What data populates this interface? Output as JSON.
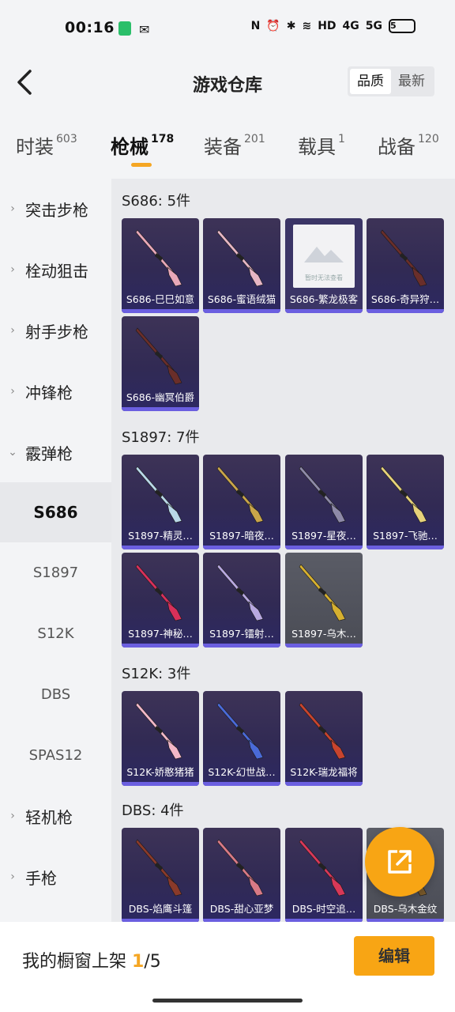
{
  "status_bar": {
    "time": "00:16",
    "network": "5G",
    "hd": "HD",
    "lte": "4G",
    "battery": "5"
  },
  "header": {
    "title": "游戏仓库",
    "sort_options": [
      "品质",
      "最新"
    ],
    "active_sort": "品质"
  },
  "category_tabs": [
    {
      "label": "时装",
      "count": "603"
    },
    {
      "label": "枪械",
      "count": "178",
      "active": true
    },
    {
      "label": "装备",
      "count": "201"
    },
    {
      "label": "载具",
      "count": "1"
    },
    {
      "label": "战备",
      "count": "120"
    }
  ],
  "sidebar": {
    "items": [
      {
        "label": "突击步枪",
        "type": "group"
      },
      {
        "label": "栓动狙击",
        "type": "group"
      },
      {
        "label": "射手步枪",
        "type": "group"
      },
      {
        "label": "冲锋枪",
        "type": "group"
      },
      {
        "label": "霰弹枪",
        "type": "group-open"
      },
      {
        "label": "S686",
        "type": "sub",
        "selected": true
      },
      {
        "label": "S1897",
        "type": "sub"
      },
      {
        "label": "S12K",
        "type": "sub"
      },
      {
        "label": "DBS",
        "type": "sub"
      },
      {
        "label": "SPAS12",
        "type": "sub"
      },
      {
        "label": "轻机枪",
        "type": "group"
      },
      {
        "label": "手枪",
        "type": "group"
      }
    ]
  },
  "groups": [
    {
      "title": "S686: 5件",
      "items": [
        {
          "name": "S686-巳巳如意",
          "color": "#e8a8b8"
        },
        {
          "name": "S686-蜜语绒猫",
          "color": "#e6b6c4"
        },
        {
          "name": "S686-繁龙极客",
          "placeholder": true,
          "placeholder_text": "暂时无法查看"
        },
        {
          "name": "S686-奇异狩…",
          "color": "#6a2e2a"
        },
        {
          "name": "S686-幽冥伯爵",
          "color": "#6a2e2a"
        }
      ]
    },
    {
      "title": "S1897: 7件",
      "items": [
        {
          "name": "S1897-精灵…",
          "color": "#b9d8e8"
        },
        {
          "name": "S1897-暗夜…",
          "color": "#c9a54a"
        },
        {
          "name": "S1897-星夜…",
          "color": "#8e8aa8"
        },
        {
          "name": "S1897-飞驰…",
          "color": "#e6d27a"
        },
        {
          "name": "S1897-神秘…",
          "color": "#d8305a"
        },
        {
          "name": "S1897-镭射…",
          "color": "#b8a8e0"
        },
        {
          "name": "S1897-乌木…",
          "color": "#d6b030",
          "grey": true
        }
      ]
    },
    {
      "title": "S12K: 3件",
      "items": [
        {
          "name": "S12K-娇憨猪猪",
          "color": "#f2b8c8"
        },
        {
          "name": "S12K-幻世战…",
          "color": "#4a6ad8"
        },
        {
          "name": "S12K-瑞龙福将",
          "color": "#c8442e"
        }
      ]
    },
    {
      "title": "DBS: 4件",
      "items": [
        {
          "name": "DBS-焰鹰斗篷",
          "color": "#8a3a2a"
        },
        {
          "name": "DBS-甜心亚梦",
          "color": "#d87a86"
        },
        {
          "name": "DBS-时空追…",
          "color": "#d83858"
        },
        {
          "name": "DBS-乌木金纹",
          "color": "#7a5a2a",
          "grey": true
        }
      ]
    }
  ],
  "bottom_bar": {
    "prefix": "我的橱窗上架 ",
    "current": "1",
    "suffix": "/5",
    "edit_label": "编辑"
  },
  "colors": {
    "accent": "#f8a514",
    "rarity": "#6b5fe0"
  }
}
